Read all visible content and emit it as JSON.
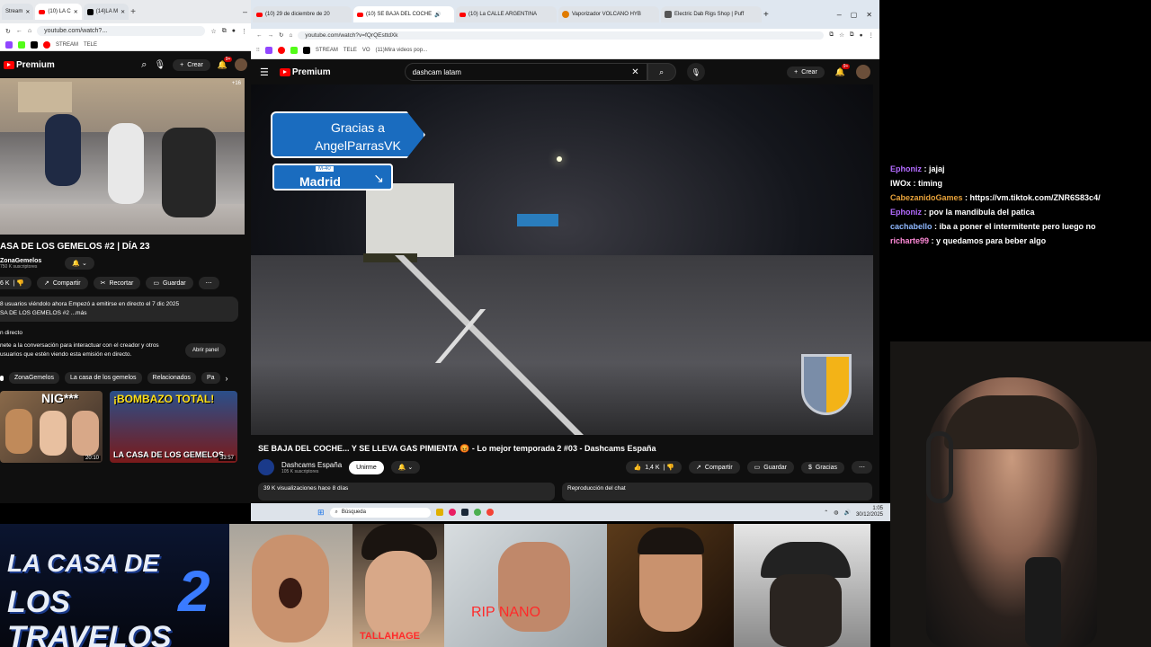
{
  "left_browser": {
    "tabs": [
      "Stream",
      "(10) LA C",
      "(14)LA M"
    ],
    "url": "youtube.com/watch?...",
    "bookmarks": [
      "STREAM",
      "TELE"
    ],
    "logo": "Premium",
    "crear": "Crear",
    "notif_badge": "9+",
    "video_badge": "+16",
    "title": "ASA DE LOS GEMELOS #2 | DÍA 23",
    "channel": "ZonaGemelos",
    "subs": "750 K suscriptores",
    "likes": "6 K",
    "compartir": "Compartir",
    "recortar": "Recortar",
    "guardar": "Guardar",
    "desc1": "8 usuarios viéndolo ahora  Empezó a emitirse en directo el 7 dic 2025",
    "desc2": "SA DE LOS GEMELOS #2 ...más",
    "live_label": "n directo",
    "live_text": "nete a la conversación para interactuar con el creador y otros usuarios que estén viendo esta emisión en directo.",
    "abrir_panel": "Abrir panel",
    "chips": [
      "ZonaGemelos",
      "La casa de los gemelos",
      "Relacionados",
      "Pa"
    ],
    "thumbs": [
      {
        "text": "NIG***",
        "dur": "20:10"
      },
      {
        "text": "¡BOMBAZO TOTAL!",
        "sub": "LA CASA DE LOS GEMELOS",
        "dur": "33:57"
      }
    ]
  },
  "right_browser": {
    "tabs": [
      "(10) 29 de diciembre de 20",
      "(10) SE BAJA DEL COCHE",
      "(10) La CALLE ARGENTINA",
      "Vaporizador VOLCANO HYB",
      "Electric Dab Rigs Shop | Puff"
    ],
    "url": "youtube.com/watch?v=fQrQEsttdXk",
    "bookmarks": [
      "STREAM",
      "TELE",
      "VO",
      "(11)Mira videos pop..."
    ],
    "logo": "Premium",
    "search_value": "dashcam latam",
    "crear": "Crear",
    "notif_badge": "9+",
    "sign1": "Gracias a AngelParrasVK",
    "sign2_small": "M-40",
    "sign2": "Madrid",
    "title": "SE BAJA DEL COCHE... Y SE LLEVA GAS PIMIENTA 😡 - Lo mejor temporada 2 #03 - Dashcams España",
    "channel": "Dashcams España",
    "subs": "105 K suscriptores",
    "unirme": "Unirme",
    "likes": "1,4 K",
    "compartir": "Compartir",
    "guardar": "Guardar",
    "gracias": "Gracias",
    "views": "39 K visualizaciones  hace 8 días",
    "chat_replay": "Reproducción del chat"
  },
  "taskbar": {
    "search": "Búsqueda",
    "time": "1:05",
    "date": "30/12/2025"
  },
  "chat": [
    {
      "user": "Ephoniz",
      "msg": "jajaj",
      "color": "#b36bff"
    },
    {
      "user": "IWOx",
      "msg": "timing",
      "color": "#ffffff"
    },
    {
      "user": "CabezanidoGames",
      "msg": "https://vm.tiktok.com/ZNR6S83c4/",
      "color": "#e8a23a"
    },
    {
      "user": "Ephoniz",
      "msg": "pov la mandibula del patica",
      "color": "#b36bff"
    },
    {
      "user": "cachabello",
      "msg": "iba a poner el intermitente pero luego no",
      "color": "#8fb8ff"
    },
    {
      "user": "richarte99",
      "msg": "y quedamos para beber algo",
      "color": "#ff8ad8"
    }
  ],
  "overlay": {
    "logo_line1": "LA CASA DE",
    "logo_line2": "LOS TRAVELOS",
    "logo_num": "2",
    "label1": "TALLAHAGE",
    "label2": "RIP NANO"
  },
  "colors": {
    "yt_red": "#ff0000",
    "sign_blue": "#1a6cbf",
    "chat_purple": "#b36bff"
  }
}
